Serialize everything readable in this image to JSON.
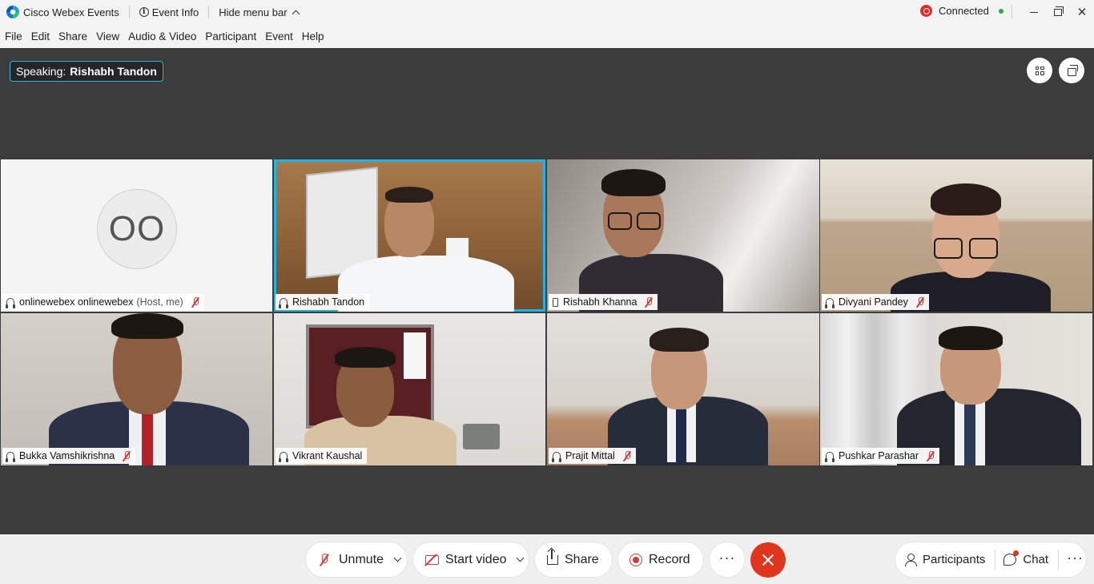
{
  "titlebar": {
    "app_name": "Cisco Webex Events",
    "event_info": "Event Info",
    "hide_menu": "Hide menu bar",
    "status": "Connected"
  },
  "menu": [
    "File",
    "Edit",
    "Share",
    "View",
    "Audio & Video",
    "Participant",
    "Event",
    "Help"
  ],
  "speaking": {
    "label": "Speaking:",
    "name": "Rishabh Tandon"
  },
  "tiles": [
    {
      "name": "onlinewebex onlinewebex",
      "host_tag": "(Host, me)",
      "initials": "OO",
      "muted": true,
      "audio": "headset"
    },
    {
      "name": "Rishabh Tandon",
      "active": true,
      "muted": false,
      "audio": "computer"
    },
    {
      "name": "Rishabh Khanna",
      "muted": true,
      "audio": "phone"
    },
    {
      "name": "Divyani Pandey",
      "muted": true,
      "audio": "headset"
    },
    {
      "name": "Bukka Vamshikrishna",
      "muted": true,
      "audio": "headset"
    },
    {
      "name": "Vikrant Kaushal",
      "muted": false,
      "audio": "headset"
    },
    {
      "name": "Prajit Mittal",
      "muted": true,
      "audio": "headset"
    },
    {
      "name": "Pushkar Parashar",
      "muted": true,
      "audio": "headset"
    }
  ],
  "controls": {
    "unmute": "Unmute",
    "start_video": "Start video",
    "share": "Share",
    "record": "Record",
    "more": "···",
    "participants": "Participants",
    "chat": "Chat",
    "right_more": "···"
  },
  "colors": {
    "accent": "#1fb3e6",
    "end_call": "#e0361e",
    "muted": "#d43a3a",
    "stage": "#3c3c3c"
  }
}
